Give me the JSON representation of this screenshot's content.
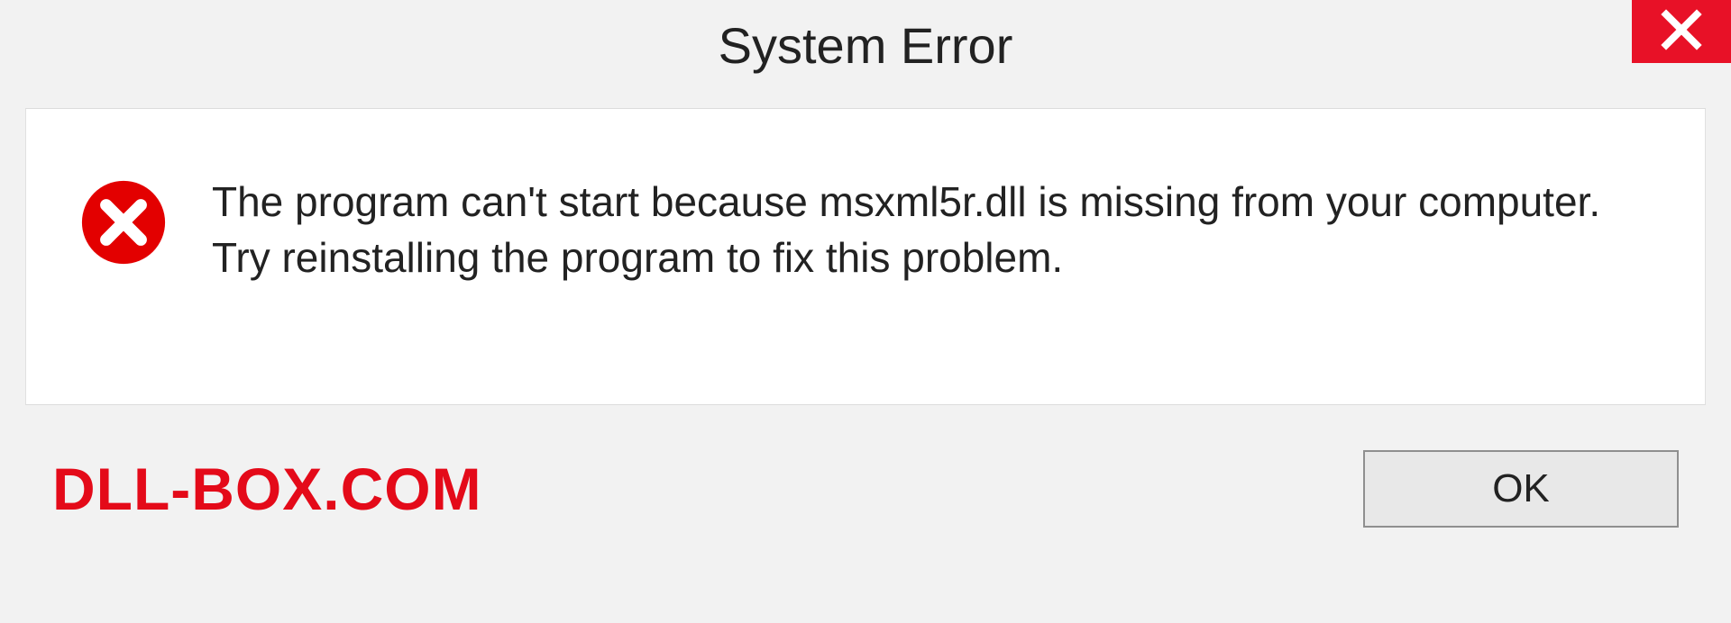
{
  "dialog": {
    "title": "System Error",
    "message": "The program can't start because msxml5r.dll is missing from your computer. Try reinstalling the program to fix this problem.",
    "ok_label": "OK"
  },
  "watermark": "DLL-BOX.COM",
  "colors": {
    "close_bg": "#e81127",
    "error_red": "#e30000",
    "watermark": "#e40a19"
  }
}
